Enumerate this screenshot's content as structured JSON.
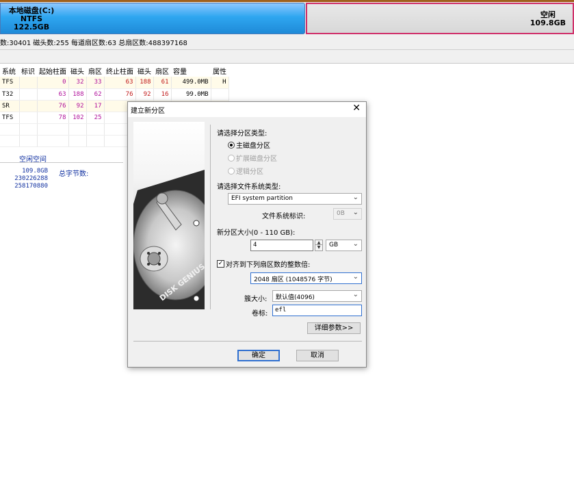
{
  "disk_map": {
    "partition_c": {
      "name": "本地磁盘(C:)",
      "fs": "NTFS",
      "size": "122.5GB"
    },
    "free": {
      "name": "空闲",
      "size": "109.8GB"
    }
  },
  "geometry_text": "数:30401  磁头数:255  每道扇区数:63  总扇区数:488397168",
  "partition_table": {
    "headers": [
      "系统",
      "标识",
      "起始柱面",
      "磁头",
      "扇区",
      "终止柱面",
      "磁头",
      "扇区",
      "容量",
      "属性"
    ],
    "rows": [
      {
        "fs": "TFS",
        "id": "",
        "start_cyl": "0",
        "start_head": "32",
        "start_sec": "33",
        "end_cyl": "63",
        "end_head": "188",
        "end_sec": "61",
        "capacity": "499.0MB",
        "attr": "H"
      },
      {
        "fs": "T32",
        "id": "",
        "start_cyl": "63",
        "start_head": "188",
        "start_sec": "62",
        "end_cyl": "76",
        "end_head": "92",
        "end_sec": "16",
        "capacity": "99.0MB",
        "attr": ""
      },
      {
        "fs": "SR",
        "id": "",
        "start_cyl": "76",
        "start_head": "92",
        "start_sec": "17",
        "end_cyl": "",
        "end_head": "",
        "end_sec": "",
        "capacity": "",
        "attr": ""
      },
      {
        "fs": "TFS",
        "id": "",
        "start_cyl": "78",
        "start_head": "102",
        "start_sec": "25",
        "end_cyl": "",
        "end_head": "",
        "end_sec": "",
        "capacity": "",
        "attr": ""
      }
    ]
  },
  "free_space": {
    "title": "空闲空间",
    "values": [
      "109.8GB",
      "230226288",
      "258170880"
    ],
    "total_bytes_label": "总字节数:"
  },
  "dialog": {
    "title": "建立新分区",
    "close_icon": "close-icon",
    "image_brand": "DISK GENIUS",
    "partition_type_label": "请选择分区类型:",
    "radio_primary": "主磁盘分区",
    "radio_extended": "扩展磁盘分区",
    "radio_logical": "逻辑分区",
    "fs_type_label": "请选择文件系统类型:",
    "fs_type_value": "EFI system partition",
    "fs_id_label": "文件系统标识:",
    "fs_id_value": "0B",
    "size_label": "新分区大小(0 - 110 GB):",
    "size_value": "4",
    "size_unit": "GB",
    "align_label": "对齐到下列扇区数的整数倍:",
    "align_value": "2048 扇区 (1048576 字节)",
    "cluster_label": "簇大小:",
    "cluster_value": "默认值(4096)",
    "volume_label": "卷标:",
    "volume_value": "efl",
    "details_button": "详细参数>>",
    "ok_button": "确定",
    "cancel_button": "取消"
  }
}
